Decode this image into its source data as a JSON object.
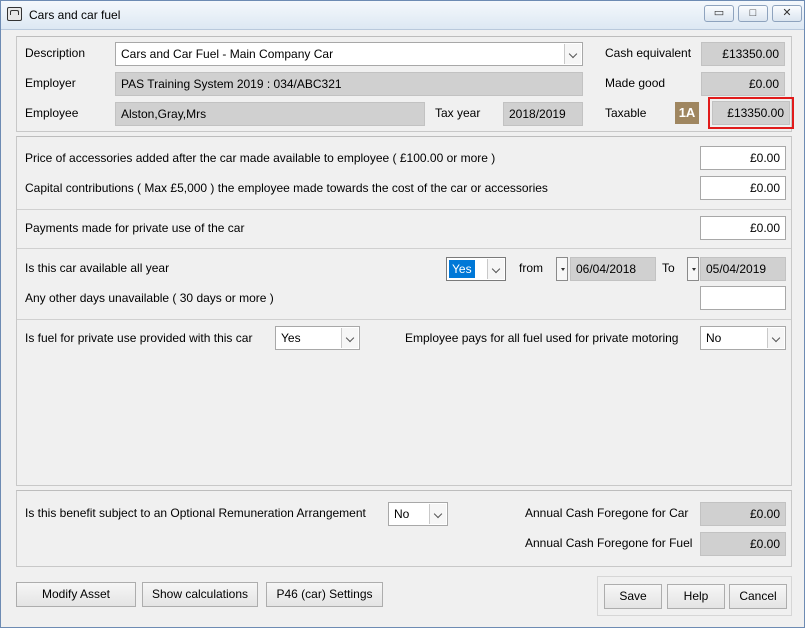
{
  "window": {
    "title": "Cars and car fuel",
    "controls": {
      "minimize": "▭",
      "maximize": "□",
      "close": "✕"
    }
  },
  "header": {
    "description_label": "Description",
    "description_value": "Cars and Car Fuel - Main Company Car",
    "employer_label": "Employer",
    "employer_value": "PAS Training System 2019 : 034/ABC321",
    "employee_label": "Employee",
    "employee_value": "Alston,Gray,Mrs",
    "tax_year_label": "Tax year",
    "tax_year_value": "2018/2019",
    "cash_equivalent_label": "Cash equivalent",
    "cash_equivalent_value": "£13350.00",
    "made_good_label": "Made good",
    "made_good_value": "£0.00",
    "taxable_label": "Taxable",
    "taxable_badge": "1A",
    "taxable_value": "£13350.00",
    "highlight_color": "#e11b1b"
  },
  "accessories": {
    "price_label": "Price of accessories added after the car made available to employee ( £100.00 or  more )",
    "price_value": "£0.00",
    "capital_label": "Capital contributions ( Max £5,000 ) the employee made towards the cost of the car or accessories",
    "capital_value": "£0.00"
  },
  "payments": {
    "label": "Payments made for private use of the car",
    "value": "£0.00"
  },
  "availability": {
    "all_year_label": "Is this car available all year",
    "all_year_value": "Yes",
    "from_label": "from",
    "from_value": "06/04/2018",
    "to_label": "To",
    "to_value": "05/04/2019",
    "other_days_label": "Any other days unavailable ( 30 days or more )",
    "other_days_value": ""
  },
  "fuel": {
    "provided_label": "Is fuel for private use provided with this car",
    "provided_value": "Yes",
    "employee_pays_label": "Employee pays for all fuel used for private motoring",
    "employee_pays_value": "No"
  },
  "ora": {
    "label": "Is this benefit subject to an Optional Remuneration Arrangement",
    "value": "No",
    "car_label": "Annual Cash Foregone for Car",
    "car_value": "£0.00",
    "fuel_label": "Annual Cash Foregone for Fuel",
    "fuel_value": "£0.00"
  },
  "buttons": {
    "modify_asset": "Modify Asset",
    "show_calculations": "Show calculations",
    "p46_settings": "P46 (car) Settings",
    "save": "Save",
    "help": "Help",
    "cancel": "Cancel"
  }
}
